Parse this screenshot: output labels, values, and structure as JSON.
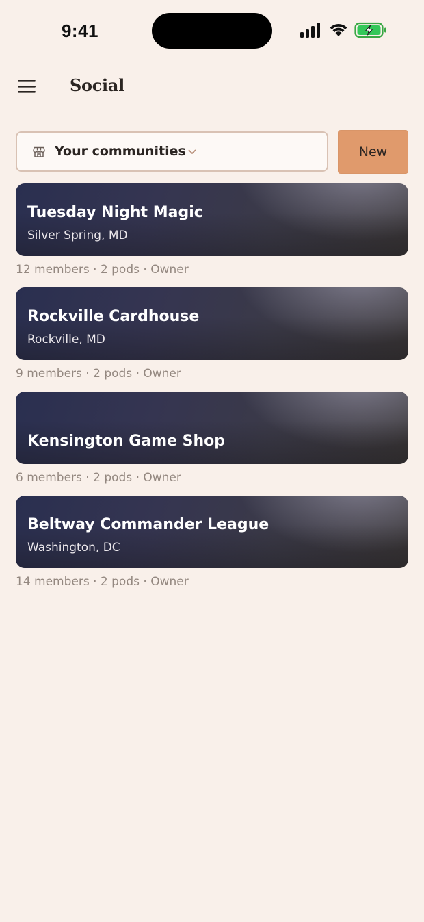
{
  "status_bar": {
    "time": "9:41",
    "icons": [
      "signal-icon",
      "wifi-icon",
      "battery-charging-icon"
    ]
  },
  "header": {
    "menu_icon": "hamburger-menu-icon",
    "title": "Social"
  },
  "filter": {
    "icon": "storefront-icon",
    "selected": "Your communities",
    "chevron_icon": "chevron-down-icon",
    "new_button_label": "New"
  },
  "communities": [
    {
      "name": "Tuesday Night Magic",
      "location": "Silver Spring, MD",
      "meta": "12 members · 2 pods · Owner"
    },
    {
      "name": "Rockville Cardhouse",
      "location": "Rockville, MD",
      "meta": "9 members · 2 pods · Owner"
    },
    {
      "name": "Kensington Game Shop",
      "location": "",
      "meta": "6 members · 2 pods · Owner"
    },
    {
      "name": "Beltway Commander League",
      "location": "Washington, DC",
      "meta": "14 members · 2 pods · Owner"
    }
  ],
  "colors": {
    "background": "#f9f0ea",
    "accent": "#e09a6c",
    "card_dark": "#2a2f50",
    "meta_text": "#948880"
  }
}
